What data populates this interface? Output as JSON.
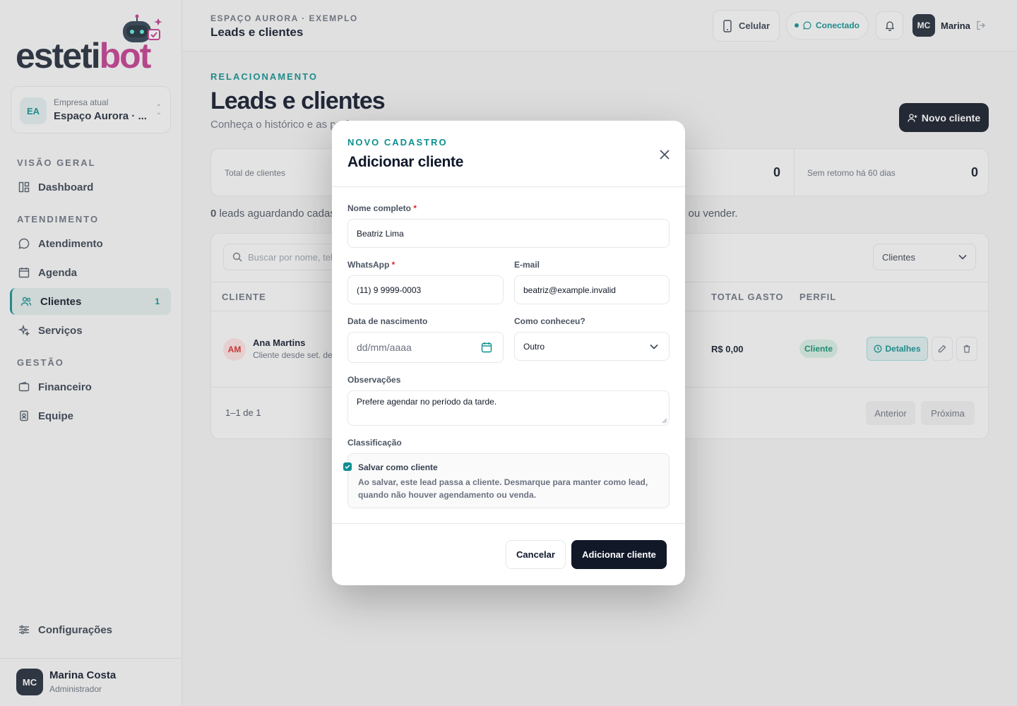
{
  "brand": {
    "logo_main": "estetibot",
    "logo_prefix": "esteti",
    "logo_suffix": "bot"
  },
  "company": {
    "initials": "EA",
    "label": "Empresa atual",
    "name": "Espaço Aurora · ..."
  },
  "sidebar": {
    "sections": [
      "VISÃO GERAL",
      "ATENDIMENTO",
      "GESTÃO"
    ],
    "items": [
      {
        "label": "Dashboard",
        "icon": "dashboard-icon"
      },
      {
        "label": "Atendimento",
        "icon": "whatsapp-icon"
      },
      {
        "label": "Agenda",
        "icon": "calendar-icon"
      },
      {
        "label": "Clientes",
        "icon": "users-icon",
        "badge": "1"
      },
      {
        "label": "Serviços",
        "icon": "sparkle-icon"
      },
      {
        "label": "Financeiro",
        "icon": "wallet-icon"
      },
      {
        "label": "Equipe",
        "icon": "badge-icon"
      }
    ],
    "settings": "Configurações"
  },
  "user": {
    "initials": "MC",
    "name": "Marina Costa",
    "role": "Administrador"
  },
  "topbar": {
    "breadcrumb": "ESPAÇO AURORA · EXEMPLO",
    "title": "Leads e clientes",
    "device_label": "Celular",
    "connection_label": "Conectado",
    "user_initials": "MC",
    "user_name": "Marina"
  },
  "page": {
    "eyebrow": "RELACIONAMENTO",
    "title": "Leads e clientes",
    "subtitle": "Conheça o histórico e as pref",
    "new_button": "Novo cliente",
    "stats": [
      {
        "label": "Total de clientes",
        "value": ""
      },
      {
        "label": "",
        "value": "0"
      },
      {
        "label": "Sem retorno há 60 dias",
        "value": "0"
      }
    ],
    "leads_count": "0",
    "leads_text": " leads aguardando cadastr",
    "leads_text_tail": "ar ou vender."
  },
  "table": {
    "search_placeholder": "Buscar por nome, tele",
    "filter_value": "Clientes",
    "headers": [
      "CLIENTE",
      "TOTAL GASTO",
      "PERFIL"
    ],
    "rows": [
      {
        "initials": "AM",
        "name": "Ana Martins",
        "since": "Cliente desde set. de",
        "total": "R$ 0,00",
        "profile": "Cliente",
        "details": "Detalhes"
      }
    ],
    "pagination": {
      "range": "1–1 de 1",
      "prev": "Anterior",
      "next": "Próxima"
    }
  },
  "modal": {
    "eyebrow": "NOVO CADASTRO",
    "title": "Adicionar cliente",
    "fields": {
      "name_label": "Nome completo",
      "name_value": "Beatriz Lima",
      "whatsapp_label": "WhatsApp",
      "whatsapp_value": "(11) 9 9999-0003",
      "email_label": "E-mail",
      "email_value": "beatriz@example.invalid",
      "birth_label": "Data de nascimento",
      "birth_placeholder": "dd/mm/aaaa",
      "source_label": "Como conheceu?",
      "source_value": "Outro",
      "notes_label": "Observações",
      "notes_value": "Prefere agendar no período da tarde.",
      "class_label": "Classificação",
      "checkbox_label": "Salvar como cliente",
      "checkbox_help": "Ao salvar, este lead passa a cliente. Desmarque para manter como lead, quando não houver agendamento ou venda."
    },
    "required_mark": "*",
    "cancel": "Cancelar",
    "submit": "Adicionar cliente"
  },
  "colors": {
    "accent": "#0e8f8f",
    "dark": "#111827",
    "brand_pink": "#c23b8f"
  }
}
